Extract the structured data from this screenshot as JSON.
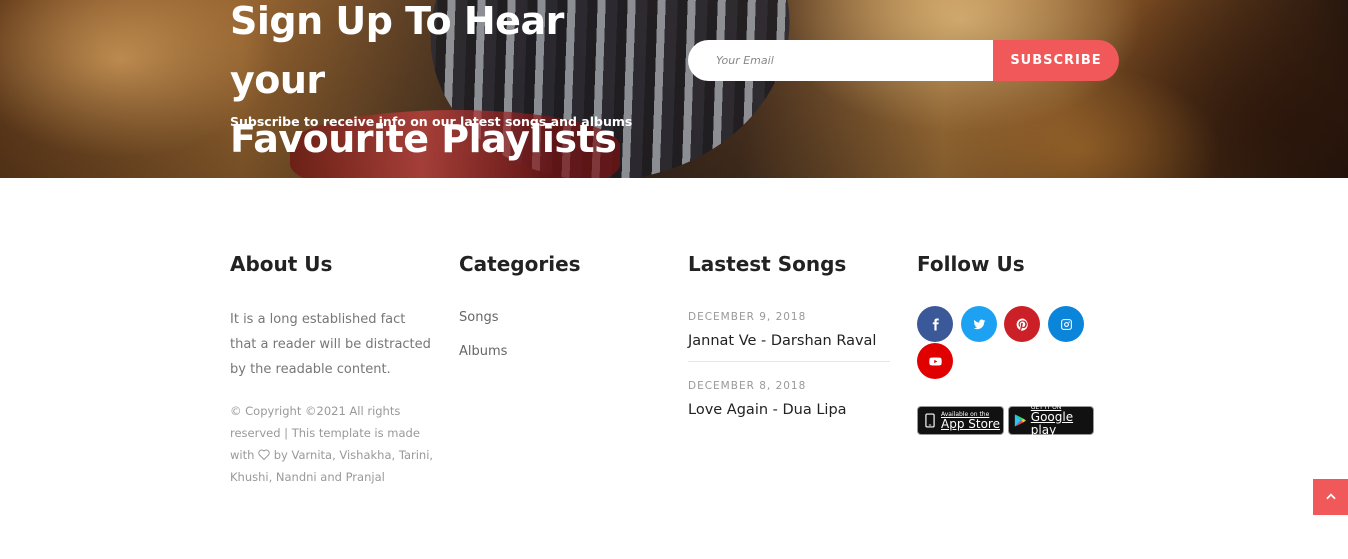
{
  "hero": {
    "title_line1": "Sign Up To Hear your",
    "title_line2": "Favourite Playlists",
    "subtitle": "Subscribe to receive info on our latest songs and albums",
    "email_placeholder": "Your Email",
    "subscribe_label": "SUBSCRIBE"
  },
  "footer": {
    "about": {
      "title": "About Us",
      "text": "It is a long established fact that a reader will be distracted by the readable content.",
      "copyright_part1": "© Copyright ©2021 All rights reserved | This template is made with",
      "copyright_part2": "by Varnita, Vishakha, Tarini, Khushi, Nandni and Pranjal"
    },
    "categories": {
      "title": "Categories",
      "items": [
        "Songs",
        "Albums"
      ]
    },
    "latest": {
      "title": "Lastest Songs",
      "songs": [
        {
          "date": "DECEMBER 9, 2018",
          "title": "Jannat Ve - Darshan Raval"
        },
        {
          "date": "DECEMBER 8, 2018",
          "title": "Love Again - Dua Lipa"
        }
      ]
    },
    "follow": {
      "title": "Follow Us",
      "social": [
        {
          "icon": "facebook-icon",
          "color": "#3b5998"
        },
        {
          "icon": "twitter-icon",
          "color": "#1da1f2"
        },
        {
          "icon": "pinterest-icon",
          "color": "#cb2027"
        },
        {
          "icon": "instagram-icon",
          "color": "#0a85d9"
        },
        {
          "icon": "youtube-icon",
          "color": "#e00000"
        }
      ],
      "app_store": {
        "small": "Available on the",
        "big": "App Store"
      },
      "google_play": {
        "small": "GET IT ON",
        "big": "Google play"
      }
    }
  },
  "colors": {
    "accent": "#f0585a"
  }
}
